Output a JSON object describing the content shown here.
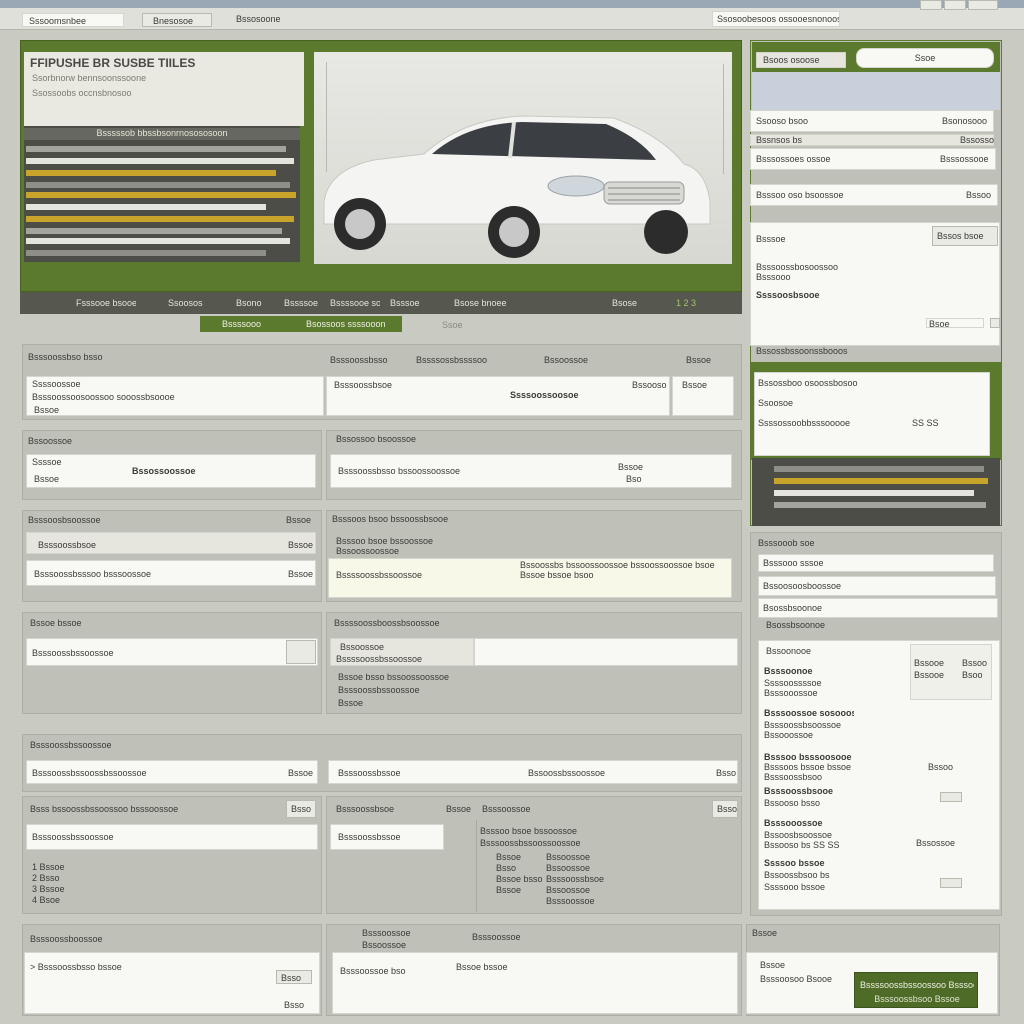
{
  "colors": {
    "accent_green": "#5b7a2e",
    "panel_bg": "#bfc1b8",
    "page_bg": "#c9cbc2",
    "yellow_stripe": "#c9a42a",
    "car_white": "#f2f2f2"
  },
  "topbar": {
    "tab1": "Sssoomsnbee",
    "tab2": "Bnesosoe",
    "tab3": "Bssosoone",
    "address": "Ssosoobesoos ossooesnonoosoioo",
    "window_controls": [
      "minimize-icon",
      "maximize-icon",
      "close-icon"
    ]
  },
  "hero": {
    "title": "FFIPUSHE BR SUSBE TIILES",
    "subtitle": "Ssorbnorw bennsoonssoone",
    "subtitle2": "Ssossoobs occnsbnosoo",
    "chart_header": "Bsssssob bbssbsonrnosososoon",
    "nav_items": [
      "Fsssooe bsooe",
      "Ssoosos",
      "Bsono",
      "Bssssoe",
      "Bssssooe sooe",
      "Bsssoe",
      "Bsose bnoee"
    ],
    "nav_right": "Bsose",
    "nav_page": "1 2 3",
    "tag1": "Bssssooo",
    "tag2": "Bsossoos ssssooon",
    "tag3": "Ssoe"
  },
  "sidebar": {
    "search_label": "Bsoos osoose",
    "search_button": "Ssoe",
    "rows": [
      {
        "label": "Ssooso bsoo",
        "value": "Bsonosooo"
      },
      {
        "label": "Bssnsos bs",
        "value": "Bssossoo"
      },
      {
        "label": "Bsssossoes ossoe",
        "value": "Bsssossooe"
      },
      {
        "label": "Bsssoo oso bsoossoe",
        "value": "Bssoo"
      }
    ],
    "box1": {
      "title": "Bsssoe",
      "button": "Bssos bsoe",
      "line1": "Bsssoossbosoossoo",
      "line2": "Bsssooo",
      "line3": "Ssssoosbsooe",
      "input": "Bsoe",
      "line4": "Bssossbssoonssbooos"
    },
    "box2": {
      "title": "Bssossboo osoossbosoo",
      "line1": "Ssoosoe",
      "line2": "Ssssossoobbsssooooe",
      "value": "SS SS"
    },
    "box3": {
      "header": "Bsssooob soe",
      "items": [
        "Bsssooo sssoe",
        "Bssoosoosboossoe",
        "Bsossbsoonoe"
      ],
      "group1": {
        "title": "Bsssoonoe",
        "lines": [
          "Ssssoossssoe",
          "Bsssooossoe",
          "Bssoonooe"
        ]
      },
      "group2": {
        "title": "Bsssoossoe sosooosoe",
        "lines": [
          "Bsssoossbsoossoe",
          "Bssooossoe"
        ]
      },
      "group3": {
        "title": "Bsssoo bsssoosooe",
        "lines": [
          "Bsssoos bssoe bssoe",
          "Bsssoossbsoo"
        ],
        "value": "Bssoo"
      },
      "group4": {
        "title": "Bsssoossbsooe",
        "lines": [
          "Bssooso bsso",
          "Bssossoo"
        ]
      },
      "group5": {
        "title": "Bsssooossoe",
        "lines": [
          "Bssoosbsoossoe",
          "Bssooso bs SS SS"
        ],
        "value": "Bssossoe"
      },
      "group6": {
        "title": "Ssssoo bssoe",
        "lines": [
          "Bssoossbsoo bs",
          "Ssssooo bssoe"
        ]
      },
      "mini_table": [
        "Bssooe",
        "Bssoo",
        "Bssooe",
        "Bsoo"
      ]
    },
    "box4": {
      "title": "Bssoe",
      "line1": "Bssoe",
      "line2": "Bsssoosoo Bsooe",
      "button": "Bssssoossbssoossoo Bsssoe",
      "button_sub": "Bsssoossbsoo Bssoe"
    }
  },
  "forms": {
    "row1": {
      "header": [
        "Bsssoossbso bsso",
        "Bsssoossbsso",
        "Bssssossbssssoo",
        "Bssoossoe",
        "Bssoe"
      ],
      "left_label": "Ssssoossoe",
      "left_line": "Bsssoossoosoossoo sooossbsoooe",
      "left_small": "Bssoe",
      "mid": "Bsssoossbsoe",
      "center": "Ssssoossoosoe",
      "right": "Bssooso",
      "right2": "Bssoe"
    },
    "row2": {
      "left_title": "Bssoossoe",
      "left_label": "Ssssoe",
      "left_value": "Bssossoossoe",
      "left_small": "Bssoe",
      "right_title": "Bssossoo bsoossoe",
      "right_value": "Bsssoossbsso bssoossoossoe",
      "right_small": "Bssoe",
      "right_small2": "Bso"
    },
    "row3": {
      "left_title": "Bsssoosbsoossoe",
      "left_right": "Bssoe",
      "left_sub": "Bsssoossbsoe",
      "left_sub_right": "Bssoe",
      "left_value": "Bsssoossbsssoo bsssoossoe",
      "left_value_right": "Bssoe",
      "right_title": "Bsssoos bsoo bssoossbsooe",
      "right_sub": "Bsssoo bsoe bssoossoe",
      "right_sub2": "Bssoossoossoe",
      "right_value": "Bssssoossbssoossoe",
      "right_text": "Bssoossbs bssoossoossoe bssoossoossoe bsoe",
      "right_text2": "Bssoe bssoe bsoo"
    },
    "row4": {
      "left_title": "Bssoe bssoe",
      "left_value": "Bsssoossbssoossoe",
      "right_title": "Bssssoossboossbsoossoe",
      "right_tab": "Bssoossoe",
      "right_tab2": "Bssssoossbssoossoe",
      "right_lines": [
        "Bssoe bsso bssoossoossoe",
        "Bsssoossbssoossoe",
        "Bssoe"
      ]
    },
    "row5": {
      "title": "Bsssoossbssoossoe",
      "left_value": "Bsssoossbssoossbssoossoe",
      "left_right": "Bssoe",
      "right_value": "Bsssoossbssoe",
      "right_value2": "Bssoossbssoossoe",
      "right_right": "Bsso"
    },
    "row6": {
      "left_title": "Bsss bssoossbssoossoo bsssoossoe",
      "left_btn": "Bsso",
      "left_value": "Bsssoossbssoossoe",
      "list": [
        "1  Bssoe",
        "2  Bsso",
        "3  Bssoe",
        "4  Bsoe"
      ],
      "right_title": "Bsssoossbsoe",
      "right_tab": "Bssoe",
      "right_tab2": "Bsssoossoe",
      "right_btn": "Bsso",
      "right_value": "Bsssoossbssoe",
      "right_lines": [
        "Bsssoo bsoe bssoossoe",
        "Bsssoossbssoossoossoe",
        "Bssoe",
        "Bsso",
        "Bssoe bsso",
        "Bssoe"
      ],
      "right_lines2": [
        "Bssoossoe",
        "Bssoossoe",
        "Bsssoossbsoe",
        "Bssoossoe",
        "Bsssoossoe",
        "Bsssoossbssoe"
      ]
    },
    "row7": {
      "left_title": "Bsssoossboossoe",
      "left_value": "> Bsssoossbsso bssoe",
      "left_small": "Bsso",
      "left_small2": "Bsso",
      "mid_title": "Bsssoossoe",
      "mid_sub": "Bssoossoe",
      "right_title": "Bsssoossoe",
      "right_value": "Bsssoossoe bso",
      "right_value2": "Bssoe bssoe"
    }
  }
}
